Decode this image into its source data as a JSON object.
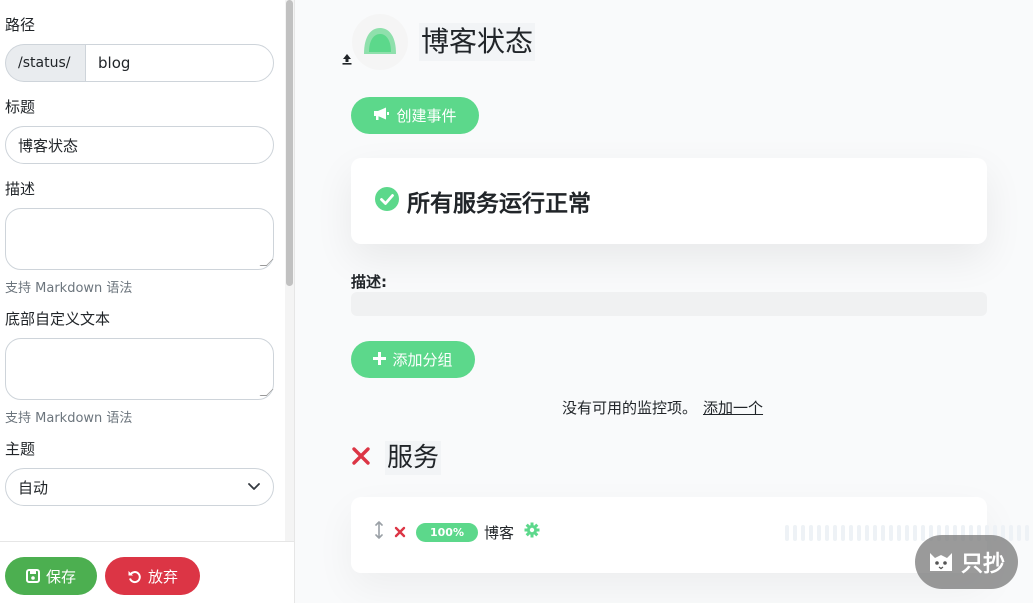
{
  "sidebar": {
    "path_label": "路径",
    "path_prefix": "/status/",
    "path_value": "blog",
    "title_label": "标题",
    "title_value": "博客状态",
    "description_label": "描述",
    "description_hint": "支持 Markdown 语法",
    "footer_label": "底部自定义文本",
    "footer_hint": "支持 Markdown 语法",
    "theme_label": "主题",
    "theme_value": "自动"
  },
  "actions": {
    "save_label": "保存",
    "discard_label": "放弃"
  },
  "main": {
    "page_title": "博客状态",
    "create_incident_label": "创建事件",
    "overall_status": "所有服务运行正常",
    "description_label": "描述:",
    "add_group_label": "添加分组",
    "empty_message": "没有可用的监控项。",
    "empty_link": "添加一个",
    "group": {
      "title": "服务",
      "monitors": [
        {
          "uptime": "100%",
          "name": "博客"
        }
      ]
    }
  },
  "heartbeat": {
    "total_bars": 36,
    "up_bars": 3
  },
  "watermark_text": "只抄",
  "colors": {
    "accent_green": "#5cd88b",
    "save_green": "#4caf50",
    "danger_red": "#dc3545"
  }
}
